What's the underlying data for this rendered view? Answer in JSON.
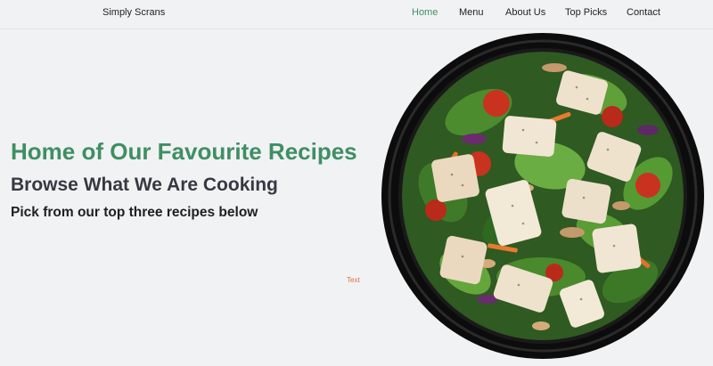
{
  "nav": {
    "brand": "Simply Scrans",
    "links": [
      {
        "label": "Home",
        "active": true
      },
      {
        "label": "Menu",
        "active": false
      },
      {
        "label": "About Us",
        "active": false
      },
      {
        "label": "Top Picks",
        "active": false
      },
      {
        "label": "Contact",
        "active": false
      }
    ]
  },
  "hero": {
    "title": "Home of Our Favourite Recipes",
    "subtitle": "Browse What We Are Cooking",
    "tagline": "Pick from our top three recipes below",
    "small_text": "Text"
  },
  "image": {
    "subject": "chicken-salad-bowl"
  },
  "colors": {
    "accent": "#3f8f63",
    "background": "#f1f2f4",
    "heading_dark": "#353a40",
    "small_text": "#e0703f"
  }
}
